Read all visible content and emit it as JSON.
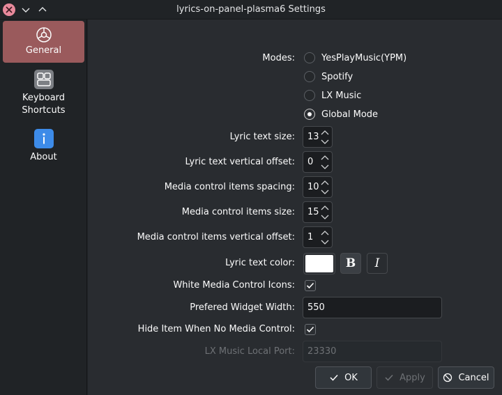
{
  "window": {
    "title": "lyrics-on-panel-plasma6 Settings"
  },
  "sidebar": {
    "items": [
      {
        "label": "General",
        "icon": "settings-gear-icon",
        "active": true
      },
      {
        "label": "Keyboard Shortcuts",
        "icon": "keyboard-shortcuts-icon",
        "active": false
      },
      {
        "label": "About",
        "icon": "info-icon",
        "active": false
      }
    ]
  },
  "form": {
    "modes_label": "Modes:",
    "modes": [
      {
        "label": "YesPlayMusic(YPM)",
        "checked": false
      },
      {
        "label": "Spotify",
        "checked": false
      },
      {
        "label": "LX Music",
        "checked": false
      },
      {
        "label": "Global Mode",
        "checked": true
      }
    ],
    "lyric_text_size": {
      "label": "Lyric text size:",
      "value": "13"
    },
    "lyric_text_vertical_offset": {
      "label": "Lyric text vertical offset:",
      "value": "0"
    },
    "media_control_items_spacing": {
      "label": "Media control items spacing:",
      "value": "10"
    },
    "media_control_items_size": {
      "label": "Media control items size:",
      "value": "15"
    },
    "media_control_items_vertical_offset": {
      "label": "Media control items vertical offset:",
      "value": "1"
    },
    "lyric_text_color": {
      "label": "Lyric text color:",
      "color": "#ffffff",
      "bold_label": "B",
      "italic_label": "I"
    },
    "white_media_control_icons": {
      "label": "White Media Control Icons:",
      "checked": true
    },
    "prefered_widget_width": {
      "label": "Prefered Widget Width:",
      "value": "550"
    },
    "hide_item_when_no_media_control": {
      "label": "Hide Item When No Media Control:",
      "checked": true
    },
    "lx_music_local_port": {
      "label": "LX Music Local Port:",
      "value": "23330",
      "disabled": true
    }
  },
  "buttons": {
    "ok": "OK",
    "apply": "Apply",
    "cancel": "Cancel"
  },
  "colors": {
    "accent": "#9a5a5c",
    "close": "#e88a9c",
    "background": "#292c30",
    "sidebar": "#202326"
  }
}
